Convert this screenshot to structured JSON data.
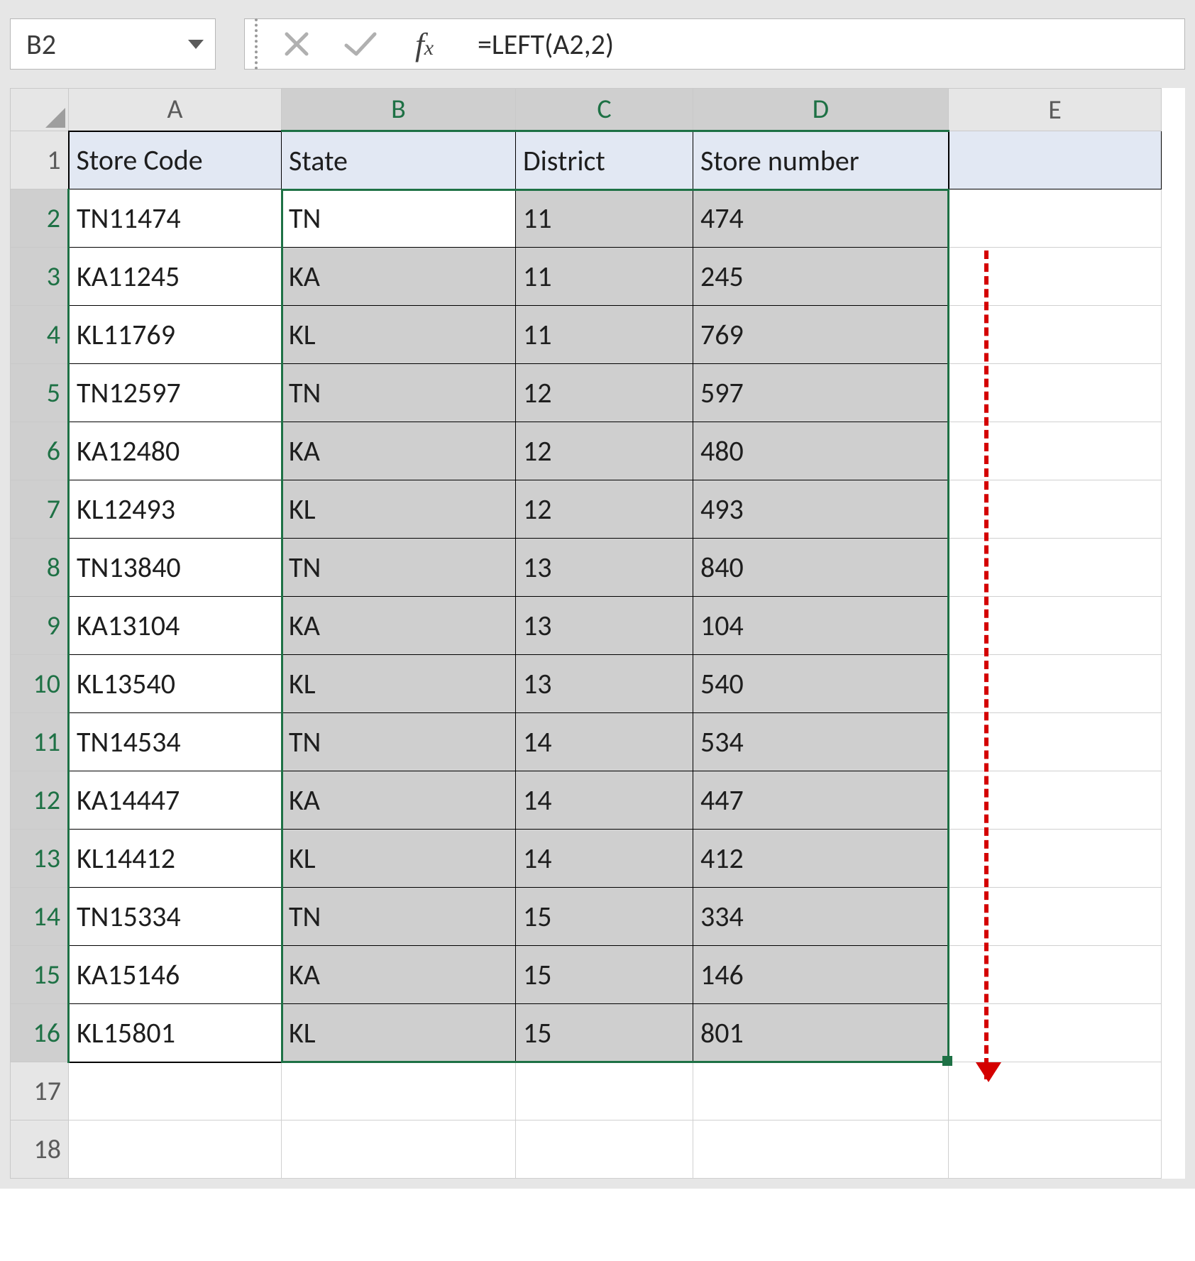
{
  "formulaBar": {
    "nameBox": "B2",
    "formula": "=LEFT(A2,2)"
  },
  "columns": [
    "A",
    "B",
    "C",
    "D",
    "E"
  ],
  "rowNumbers": [
    "1",
    "2",
    "3",
    "4",
    "5",
    "6",
    "7",
    "8",
    "9",
    "10",
    "11",
    "12",
    "13",
    "14",
    "15",
    "16",
    "17",
    "18"
  ],
  "headerRow": {
    "A": "Store Code",
    "B": "State",
    "C": "District",
    "D": "Store number"
  },
  "rows": [
    {
      "A": "TN11474",
      "B": "TN",
      "C": "11",
      "D": "474"
    },
    {
      "A": "KA11245",
      "B": "KA",
      "C": "11",
      "D": "245"
    },
    {
      "A": "KL11769",
      "B": "KL",
      "C": "11",
      "D": "769"
    },
    {
      "A": "TN12597",
      "B": "TN",
      "C": "12",
      "D": "597"
    },
    {
      "A": "KA12480",
      "B": "KA",
      "C": "12",
      "D": "480"
    },
    {
      "A": "KL12493",
      "B": "KL",
      "C": "12",
      "D": "493"
    },
    {
      "A": "TN13840",
      "B": "TN",
      "C": "13",
      "D": "840"
    },
    {
      "A": "KA13104",
      "B": "KA",
      "C": "13",
      "D": "104"
    },
    {
      "A": "KL13540",
      "B": "KL",
      "C": "13",
      "D": "540"
    },
    {
      "A": "TN14534",
      "B": "TN",
      "C": "14",
      "D": "534"
    },
    {
      "A": "KA14447",
      "B": "KA",
      "C": "14",
      "D": "447"
    },
    {
      "A": "KL14412",
      "B": "KL",
      "C": "14",
      "D": "412"
    },
    {
      "A": "TN15334",
      "B": "TN",
      "C": "15",
      "D": "334"
    },
    {
      "A": "KA15146",
      "B": "KA",
      "C": "15",
      "D": "146"
    },
    {
      "A": "KL15801",
      "B": "KL",
      "C": "15",
      "D": "801"
    }
  ]
}
